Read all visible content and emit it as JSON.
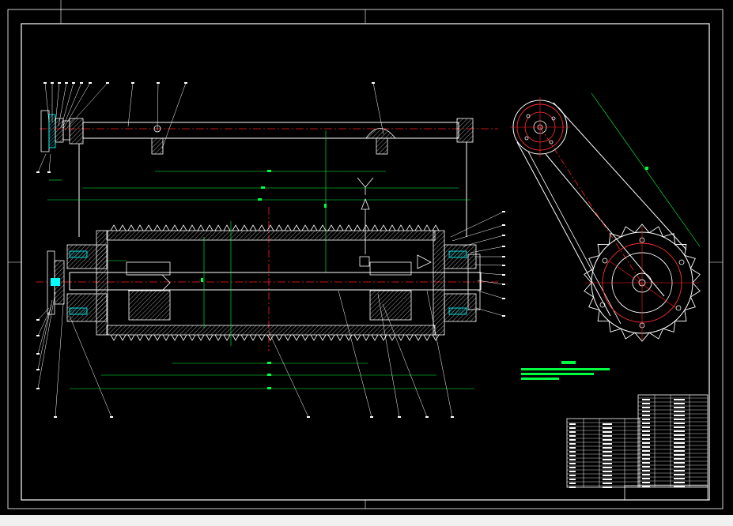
{
  "drawing": {
    "colors": {
      "background": "#000000",
      "outline": "#ffffff",
      "centerline": "#ff2020",
      "dimension": "#00ff40",
      "hatch": "#00ffff",
      "sprocket_detail": "#ff3030"
    },
    "title_block_header": "",
    "legend_note": "",
    "dimension_texts": []
  }
}
